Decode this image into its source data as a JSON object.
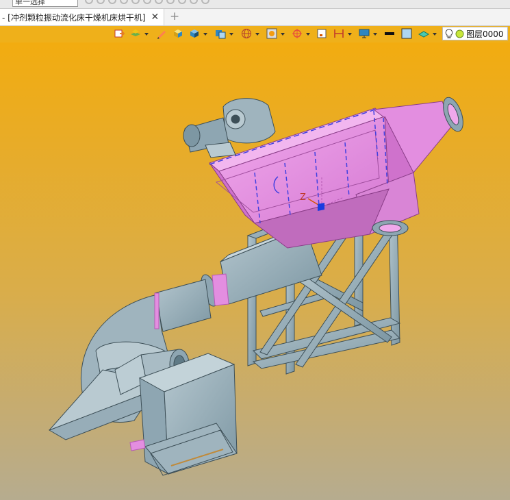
{
  "top_strip": {
    "select_mode": "单一选择"
  },
  "tab": {
    "title": "- [冲剂颗粒振动流化床干燥机床烘干机]",
    "close_glyph": "✕",
    "new_tab_glyph": "+"
  },
  "layer": {
    "name": "图层0000"
  },
  "axis": {
    "z_label": "Z"
  },
  "icons": [
    "import-icon",
    "layers-icon",
    "pencil-icon",
    "box-icon",
    "cube-icon",
    "view-cube-icon",
    "sphere-grid-icon",
    "render-icon",
    "target-icon",
    "frame-icon",
    "measure-icon",
    "monitor-icon",
    "line-color-icon",
    "fill-color-icon",
    "plane-icon",
    "lightbulb-icon"
  ],
  "colors": {
    "bg_top": "#f2ac10",
    "bg_bottom": "#b6ac8f",
    "steel": "#8ea6b2",
    "steel_dark": "#5f7a86",
    "pink": "#e38ee0",
    "pink_dark": "#b65ab4",
    "highlight_dash": "#4040e0"
  }
}
